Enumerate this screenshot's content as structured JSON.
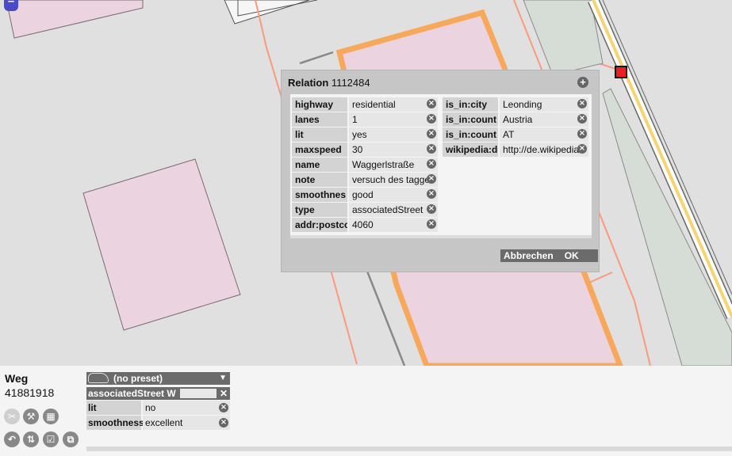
{
  "map": {
    "colors": {
      "background": "#e0e0e0",
      "building": "#ebd3e0",
      "building_stroke": "#7a6a72",
      "selected_way": "#f7a85a",
      "road": "#fa9a7a",
      "highway_yellow": "#f8d470",
      "green": "#d6ddd6",
      "selected_node": "#e82020"
    },
    "zoom_out_label": "–"
  },
  "dialog": {
    "title_bold": "Relation",
    "title_id": "1112484",
    "add_icon": "plus-icon",
    "left_tags": [
      {
        "key": "highway",
        "value": "residential"
      },
      {
        "key": "lanes",
        "value": "1"
      },
      {
        "key": "lit",
        "value": "yes"
      },
      {
        "key": "maxspeed",
        "value": "30"
      },
      {
        "key": "name",
        "value": "Waggerlstraße"
      },
      {
        "key": "note",
        "value": "versuch des tagge"
      },
      {
        "key": "smoothnes",
        "value": "good"
      },
      {
        "key": "type",
        "value": "associatedStreet"
      },
      {
        "key": "addr:postcc",
        "value": "4060"
      }
    ],
    "right_tags": [
      {
        "key": "is_in:city",
        "value": "Leonding"
      },
      {
        "key": "is_in:count",
        "value": "Austria"
      },
      {
        "key": "is_in:count",
        "value": "AT"
      },
      {
        "key": "wikipedia:de",
        "value": "http://de.wikipedia"
      }
    ],
    "cancel_label": "Abbrechen",
    "ok_label": "OK"
  },
  "bottom_panel": {
    "object_type": "Weg",
    "object_id": "41881918",
    "preset_label": "(no preset)",
    "relation_label": "associatedStreet W",
    "tags": [
      {
        "key": "lit",
        "value": "no"
      },
      {
        "key": "smoothness",
        "value": "excellent"
      }
    ],
    "tools": [
      "scissors-icon",
      "hammer-icon",
      "checkerboard-icon",
      "undo-icon",
      "reverse-icon",
      "checkbox-icon",
      "copy-icon"
    ]
  }
}
